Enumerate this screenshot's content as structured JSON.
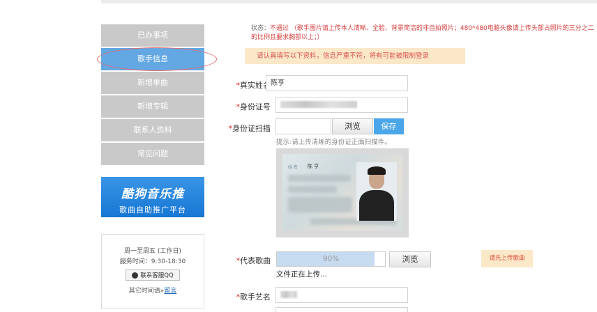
{
  "sidebar": {
    "items": [
      {
        "label": "已办事项"
      },
      {
        "label": "歌手信息"
      },
      {
        "label": "新增单曲"
      },
      {
        "label": "新增专辑"
      },
      {
        "label": "联系人资料"
      },
      {
        "label": "常见问题"
      }
    ],
    "promo": {
      "brand": "酷狗音乐推",
      "subtitle": "歌曲自助推广平台"
    },
    "service": {
      "hours_days": "周一至周五 (工作日)",
      "hours_time": "服务时间：9:30-18:30",
      "qq_button": "联系客服QQ",
      "other_time_prefix": "其它时间请»",
      "other_time_link": "留言"
    }
  },
  "status": {
    "label": "状态：",
    "text": "不通过 （歌手图片请上传本人清晰、全脸、背景简洁的非自拍照片；480*480电脑头像请上传头部占照片的三分之二的比例且要求胸部以上；）"
  },
  "notice": "请认真填写以下资料，信息严重不符，将有可能被限制登录",
  "form": {
    "real_name": {
      "label": "真实姓名",
      "value": "陈亨"
    },
    "id_number": {
      "label": "身份证号"
    },
    "id_scan": {
      "label": "身份证扫描",
      "browse": "浏览",
      "save": "保存",
      "hint": "提示:请上传清晰的身份证正面扫描件。"
    },
    "id_card": {
      "name_label": "姓 名",
      "name_value": "陈 亨"
    },
    "song": {
      "label": "代表歌曲",
      "progress_text": "90%",
      "progress": 0.9,
      "browse": "浏览",
      "uploading": "文件正在上传...",
      "upload_first": "请先上传歌曲"
    },
    "artist_name": {
      "label": "歌手艺名"
    }
  },
  "required_mark": "*"
}
